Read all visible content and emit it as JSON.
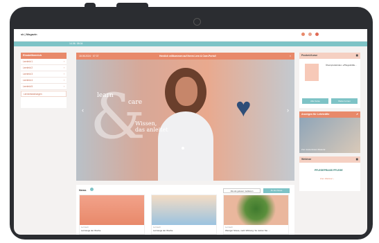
{
  "header": {
    "logo": "sk | Magazin",
    "nav_date": "14.06. 08:04"
  },
  "welcome": {
    "date": "18.06.2024 · 07:37",
    "message": "Herzlich willkommen auf Ihrem Lern & Care-Portal!",
    "close_symbol": "×"
  },
  "sidebar": {
    "title": "Einstellbereich",
    "items": [
      {
        "icon": "person-icon",
        "label": "Lernfeld 1",
        "arrow": "›"
      },
      {
        "icon": "person-icon",
        "label": "Lernfeld 2",
        "arrow": "›"
      },
      {
        "icon": "person-icon",
        "label": "Lernfeld 3",
        "arrow": "›"
      },
      {
        "icon": "person-icon",
        "label": "Lernfeld 4",
        "arrow": "›"
      },
      {
        "icon": "person-icon",
        "label": "Lernfeld 5",
        "arrow": "›"
      }
    ],
    "extra": "Lernentwicklungen"
  },
  "hero": {
    "word1": "learn",
    "word2": "care",
    "slogan_line1": "Wissen,",
    "slogan_line2": "das anleitet",
    "left_arrow": "‹",
    "right_arrow": "›"
  },
  "news": {
    "title": "News",
    "btn_all": "Alle als gelesen markieren",
    "btn_more": "Zu den News",
    "cards": [
      {
        "cat": "Lernwelt",
        "title": "Lernwege der Woche"
      },
      {
        "cat": "Lernwelt",
        "title": "Lernwege der Woche"
      },
      {
        "cat": "Lernwelt",
        "title": "Weniger Stress, mehr Wirkung: So nutzen Sie ..."
      }
    ]
  },
  "right": {
    "tablet_title": "Pocket-Kurse",
    "tablet_text": "Übersprudelndes: »Pflegekräfte...",
    "tablet_btn1": "Alle Kurse",
    "tablet_btn2": "Weiter lernen",
    "article_title": "Anzeigen für Lehrkräfte",
    "article_caption": "Zum kostenlosen Material",
    "webinar_title": "Webinar",
    "webinar_brand": "PFLEGEPRAXIS PFLEGE",
    "webinar_link": "Zum Webinar ›"
  },
  "colors": {
    "accent": "#e8896a",
    "teal": "#7ec3c6",
    "peach": "#f5b8a0"
  }
}
